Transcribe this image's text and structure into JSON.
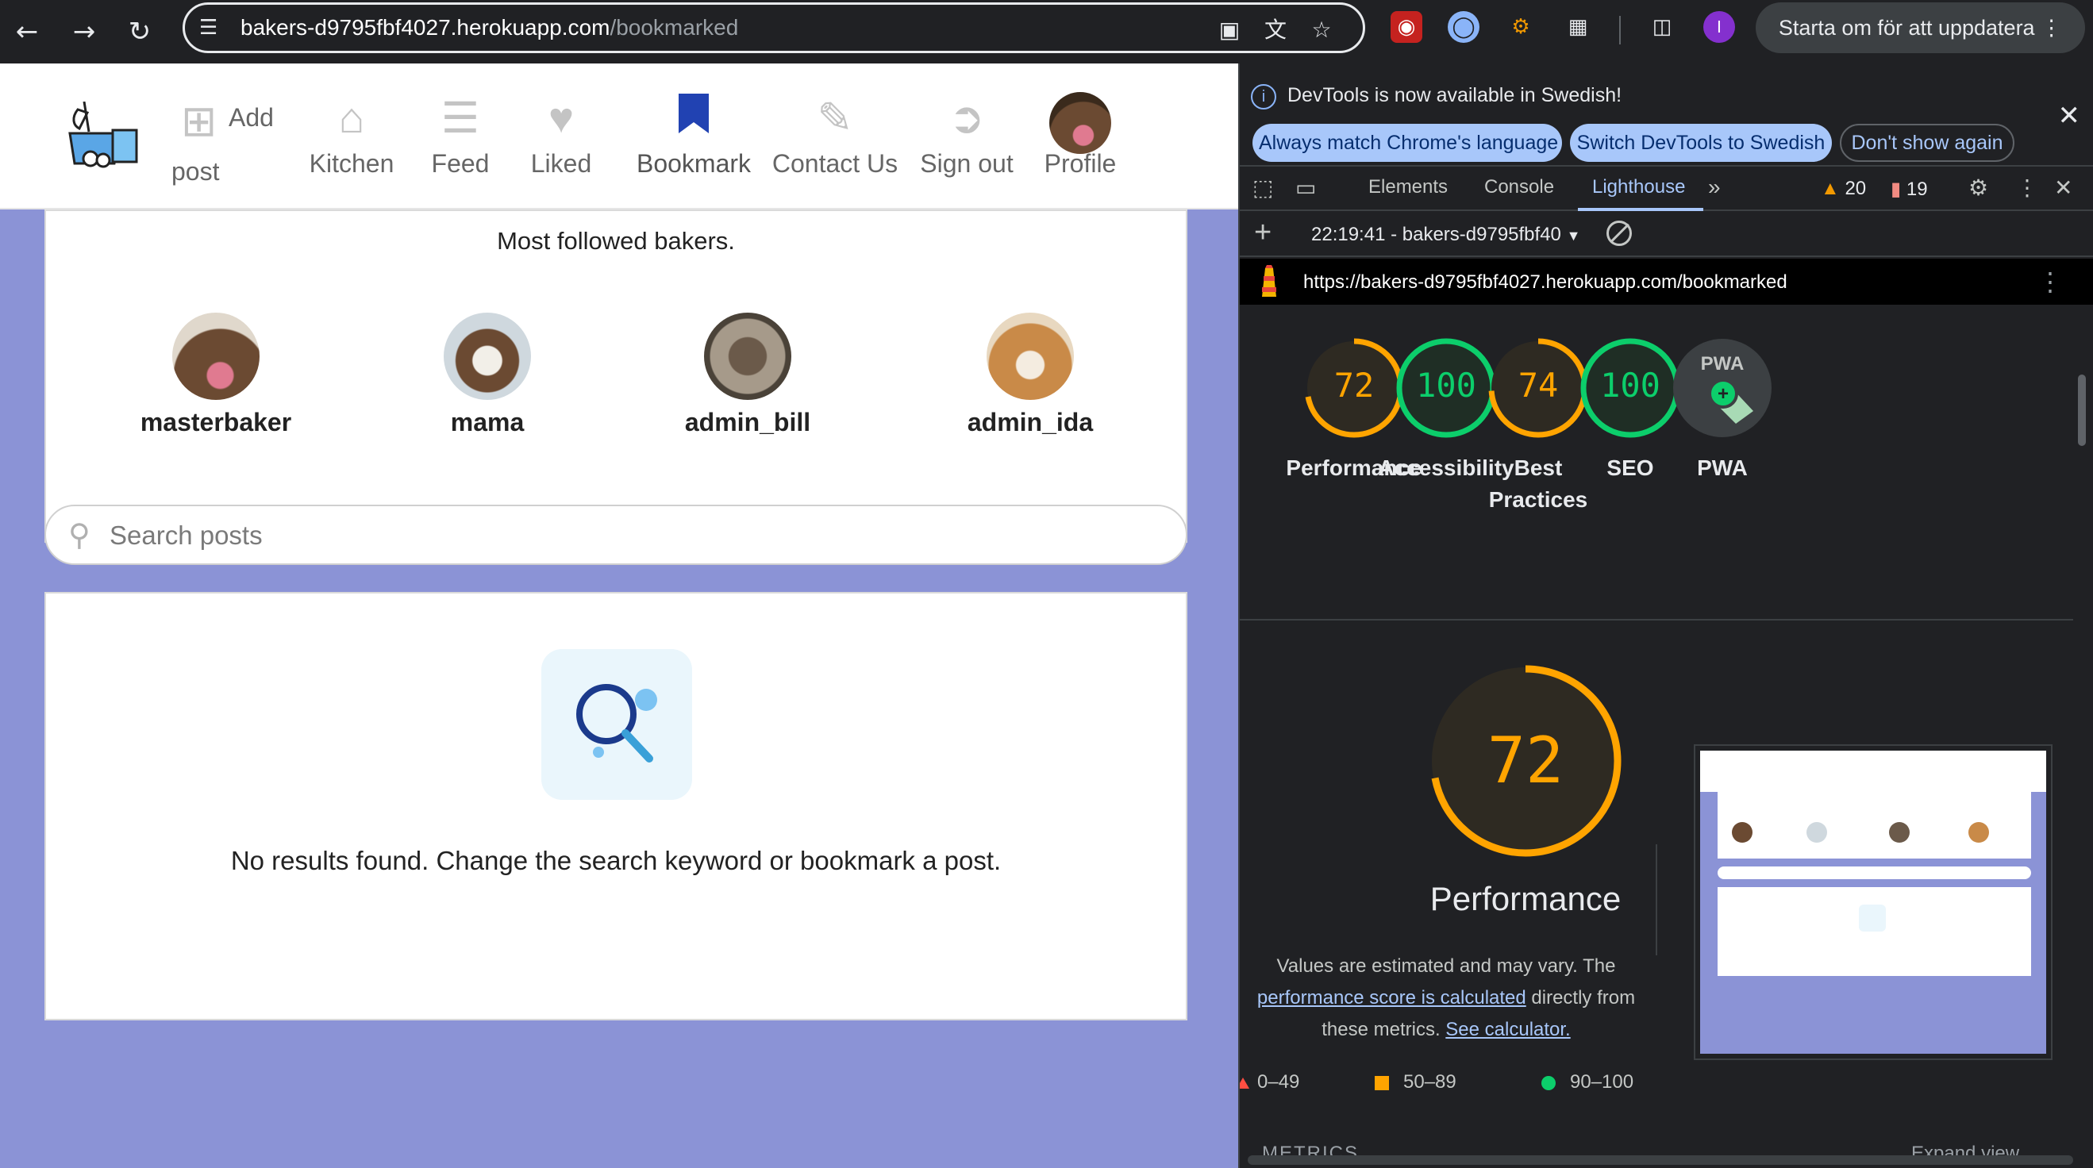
{
  "browser": {
    "url_host": "bakers-d9795fbf4027.herokuapp.com",
    "url_path": "/bookmarked",
    "update_button": "Starta om för att uppdatera",
    "icons": [
      "back-arrow-icon",
      "forward-arrow-icon",
      "reload-icon",
      "site-settings-icon",
      "install-app-icon",
      "translate-icon",
      "star-icon",
      "extension-icon",
      "puzzle-icon",
      "side-panel-icon",
      "profile-icon",
      "menu-kebab-icon"
    ],
    "profile_initial": "I"
  },
  "site": {
    "nav": [
      {
        "label_top": "Add",
        "label_bottom": "post",
        "icon": "plus-square-icon"
      },
      {
        "label": "Kitchen",
        "icon": "home-icon"
      },
      {
        "label": "Feed",
        "icon": "feed-icon"
      },
      {
        "label": "Liked",
        "icon": "heart-icon"
      },
      {
        "label": "Bookmark",
        "icon": "bookmark-icon",
        "active": true
      },
      {
        "label": "Contact Us",
        "icon": "pencil-icon"
      },
      {
        "label": "Sign out",
        "icon": "sign-out-icon"
      },
      {
        "label": "Profile",
        "icon": "avatar"
      }
    ],
    "bakers_title": "Most followed bakers.",
    "bakers": [
      "masterbaker",
      "mama",
      "admin_bill",
      "admin_ida"
    ],
    "search_placeholder": "Search posts",
    "empty_message": "No results found. Change the search keyword or bookmark a post.",
    "colors": {
      "page_bg": "#8b93d6",
      "active": "#2142b2"
    }
  },
  "devtools": {
    "banner_message": "DevTools is now available in Swedish!",
    "banner_buttons": [
      "Always match Chrome's language",
      "Switch DevTools to Swedish",
      "Don't show again"
    ],
    "tabs": [
      "Elements",
      "Console",
      "Lighthouse"
    ],
    "active_tab": "Lighthouse",
    "warnings": "20",
    "errors": "19",
    "report_selector": "22:19:41 - bakers-d9795fbf40",
    "report_url": "https://bakers-d9795fbf4027.herokuapp.com/bookmarked",
    "scores": [
      {
        "label": "Performance",
        "value": 72,
        "color": "#ffa400"
      },
      {
        "label": "Accessibility",
        "value": 100,
        "color": "#0cce6b"
      },
      {
        "label": "Best Practices",
        "value": 74,
        "color": "#ffa400"
      },
      {
        "label": "SEO",
        "value": 100,
        "color": "#0cce6b"
      },
      {
        "label": "PWA",
        "value": null,
        "color": "#9aa0a6"
      }
    ],
    "pwa_text": "PWA",
    "big_score": "72",
    "big_title": "Performance",
    "note_prefix": "Values are estimated and may vary. The ",
    "note_link": "performance score is calculated",
    "note_middle": " directly from these metrics. ",
    "note_link2": "See calculator.",
    "legend": [
      "0–49",
      "50–89",
      "90–100"
    ],
    "metrics_peek": "METRICS",
    "expand_peek": "Expand view"
  }
}
